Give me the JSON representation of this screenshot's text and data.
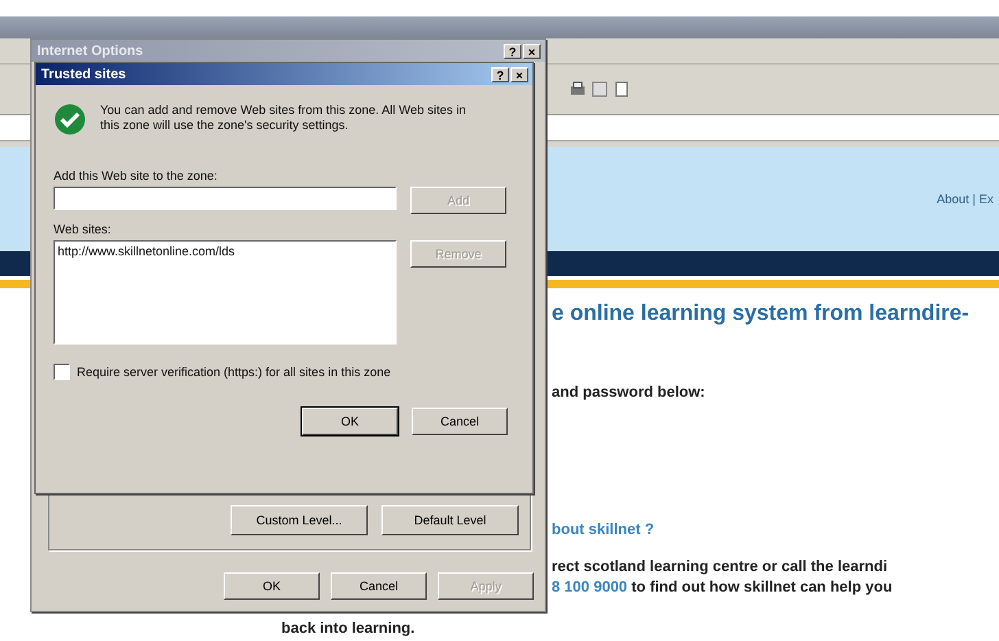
{
  "browser_page": {
    "header_link": "About | Ex",
    "heading": "e online learning system from learndire-",
    "login_prompt": "and password below:",
    "about_link": "bout skillnet ?",
    "info_line": "rect scotland learning centre or call the learndi",
    "phone_link": "8 100 9000",
    "info_tail": "to find out how skillnet can help you",
    "closing": "back into learning."
  },
  "internet_options": {
    "title": "Internet Options",
    "title_controls": [
      "?",
      "×"
    ],
    "level_buttons": [
      {
        "label": "Custom Level...",
        "disabled": false
      },
      {
        "label": "Default Level",
        "disabled": false
      }
    ],
    "footer_buttons": [
      {
        "label": "OK",
        "disabled": false
      },
      {
        "label": "Cancel",
        "disabled": false
      },
      {
        "label": "Apply",
        "disabled": true
      }
    ]
  },
  "trusted_sites": {
    "title": "Trusted sites",
    "title_controls": [
      "?",
      "×"
    ],
    "message": "You can add and remove Web sites from this zone. All Web sites in this zone will use the zone's security settings.",
    "add_label": "Add this Web site to the zone:",
    "add_button": {
      "label": "Add",
      "disabled": true
    },
    "list_label": "Web sites:",
    "sites": [
      {
        "url": "http://www.skillnetonline.com/lds",
        "selected": false
      }
    ],
    "remove_button": {
      "label": "Remove",
      "disabled": true
    },
    "verify_checkbox": {
      "label": "Require server verification (https:) for all sites in this zone",
      "checked": false
    },
    "buttons": [
      {
        "label": "OK",
        "disabled": false
      },
      {
        "label": "Cancel",
        "disabled": false
      }
    ]
  }
}
